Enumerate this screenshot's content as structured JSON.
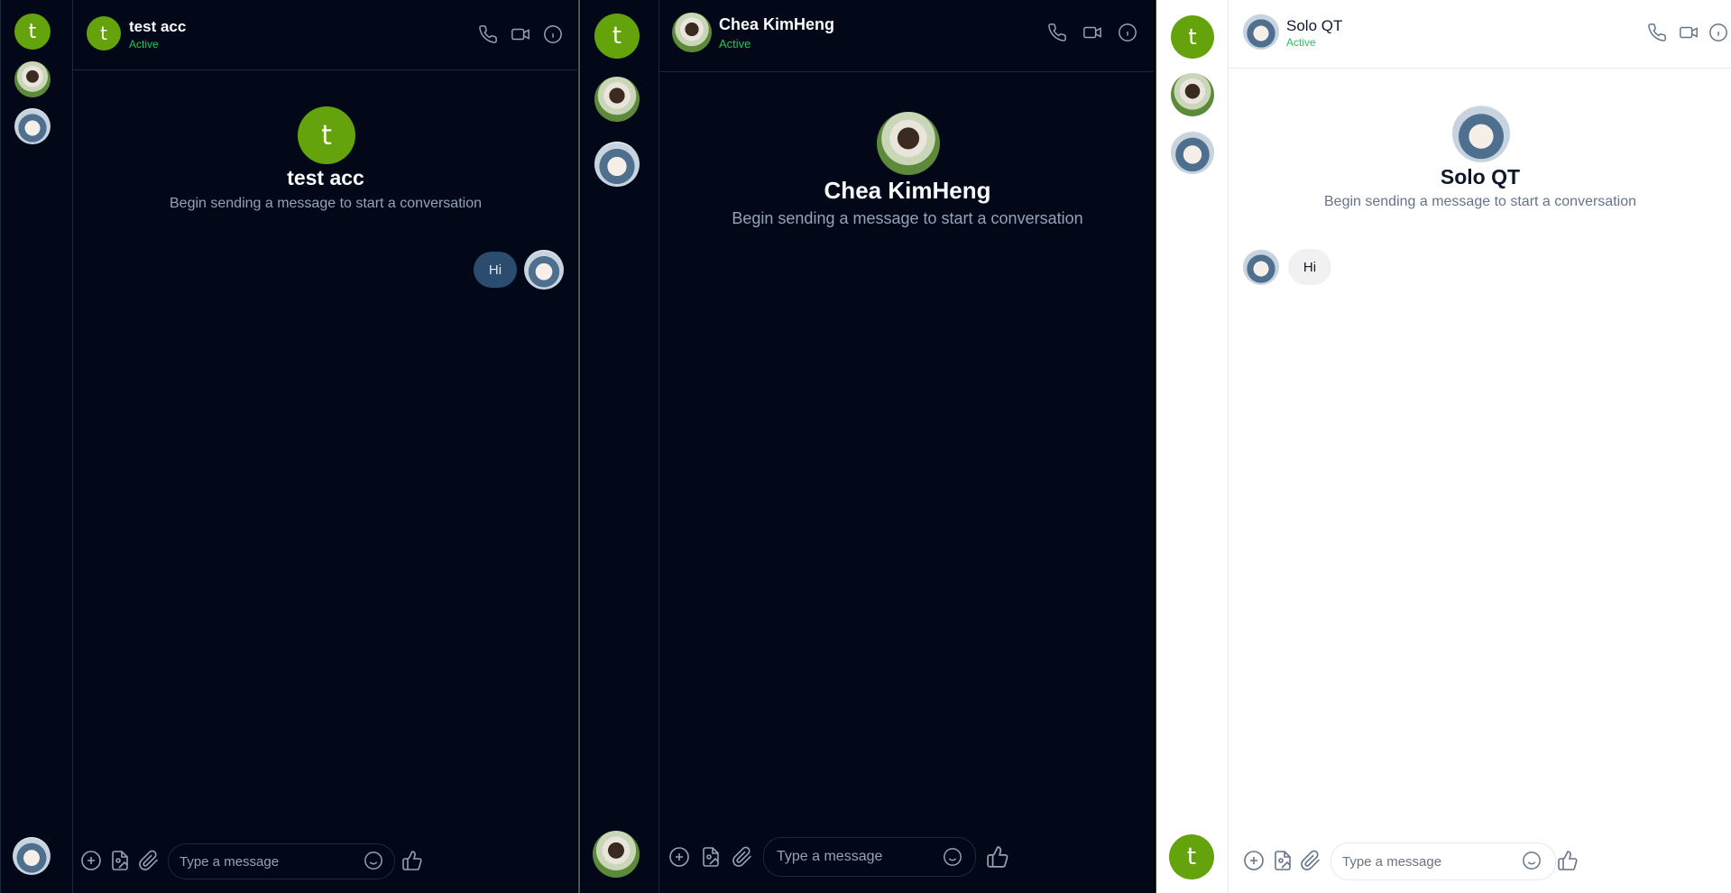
{
  "panes": [
    {
      "theme": "dark",
      "rail": {
        "top_avatar_letter": "t"
      },
      "header": {
        "name": "test acc",
        "status": "Active"
      },
      "intro": {
        "avatar_letter": "t",
        "name": "test acc",
        "text": "Begin sending a message to start a conversation"
      },
      "messages": [
        {
          "text": "Hi",
          "from": "me"
        }
      ],
      "composer": {
        "placeholder": "Type a message"
      }
    },
    {
      "theme": "dark",
      "rail": {
        "top_avatar_letter": "t"
      },
      "header": {
        "name": "Chea KimHeng",
        "status": "Active"
      },
      "intro": {
        "name": "Chea KimHeng",
        "text": "Begin sending a message to start a conversation"
      },
      "messages": [],
      "composer": {
        "placeholder": "Type a message"
      }
    },
    {
      "theme": "light",
      "rail": {
        "top_avatar_letter": "t",
        "bottom_avatar_letter": "t"
      },
      "header": {
        "name": "Solo QT",
        "status": "Active"
      },
      "intro": {
        "name": "Solo QT",
        "text": "Begin sending a message to start a conversation"
      },
      "messages": [
        {
          "text": "Hi",
          "from": "them"
        }
      ],
      "composer": {
        "placeholder": "Type a message"
      }
    }
  ],
  "colors": {
    "dark_bg": "#020817",
    "accent_green_avatar": "#65a30d",
    "active_status": "#22c55e",
    "my_bubble": "#2b4c6f",
    "their_bubble_light": "#f1f1f1"
  },
  "icons": [
    "phone-icon",
    "video-icon",
    "info-icon",
    "plus-circle-icon",
    "image-icon",
    "paperclip-icon",
    "smile-icon",
    "thumbs-up-icon"
  ]
}
